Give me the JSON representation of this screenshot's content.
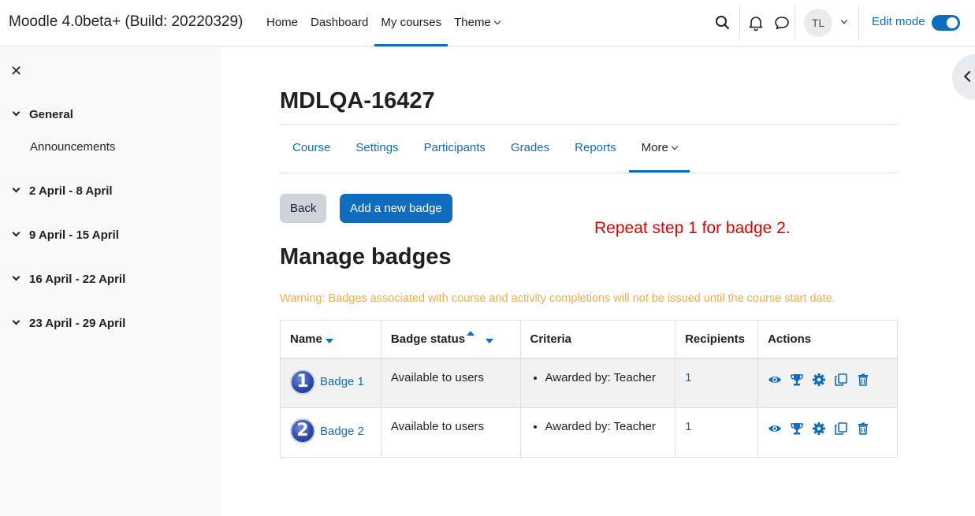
{
  "navbar": {
    "brand": "Moodle 4.0beta+ (Build: 20220329)",
    "links": [
      "Home",
      "Dashboard",
      "My courses",
      "Theme"
    ],
    "active_link": "My courses",
    "user_initials": "TL",
    "edit_mode_label": "Edit mode",
    "edit_mode_on": true
  },
  "drawer": {
    "close_glyph": "✕",
    "sections": [
      {
        "label": "General",
        "items": [
          "Announcements"
        ]
      },
      {
        "label": "2 April - 8 April",
        "items": []
      },
      {
        "label": "9 April - 15 April",
        "items": []
      },
      {
        "label": "16 April - 22 April",
        "items": []
      },
      {
        "label": "23 April - 29 April",
        "items": []
      }
    ]
  },
  "course": {
    "title": "MDLQA-16427",
    "tabs": [
      "Course",
      "Settings",
      "Participants",
      "Grades",
      "Reports",
      "More"
    ],
    "active_tab": "More"
  },
  "buttons": {
    "back": "Back",
    "add_badge": "Add a new badge"
  },
  "annotation": "Repeat step 1 for badge 2.",
  "page": {
    "heading": "Manage badges",
    "warning": "Warning: Badges associated with course and activity completions will not be issued until the course start date."
  },
  "table": {
    "headers": {
      "name": "Name",
      "status": "Badge status",
      "criteria": "Criteria",
      "recipients": "Recipients",
      "actions": "Actions"
    },
    "rows": [
      {
        "number": "1",
        "name": "Badge 1",
        "status": "Available to users",
        "criteria": "Awarded by: Teacher",
        "recipients": "1"
      },
      {
        "number": "2",
        "name": "Badge 2",
        "status": "Available to users",
        "criteria": "Awarded by: Teacher",
        "recipients": "1"
      }
    ],
    "action_icons": [
      "eye-icon",
      "trophy-icon",
      "gear-icon",
      "copy-icon",
      "trash-icon"
    ]
  },
  "colors": {
    "primary": "#0f6cbf",
    "warning": "#f0ad4e",
    "annotation": "#e00000",
    "drawer_bg": "#f8f9fa"
  }
}
